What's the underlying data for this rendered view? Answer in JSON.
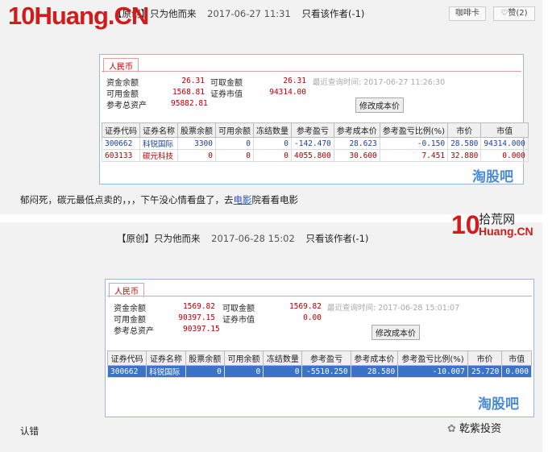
{
  "post1": {
    "header": {
      "title": "【原创】只为他而来",
      "time": "2017-06-27 11:31",
      "only_author": "只看该作者(-1)"
    },
    "buttons": {
      "coffee": "咖啡卡",
      "like": "赞(2)"
    },
    "logo": "10Huang.CN",
    "currency_tab": "人民币",
    "funds": {
      "balance_label": "资金余额",
      "balance": "26.31",
      "withdraw_label": "可取金额",
      "withdraw": "26.31",
      "query_time": "最近查询时间: 2017-06-27 11:26:30",
      "available_label": "可用金额",
      "available": "1568.81",
      "market_label": "证券市值",
      "market": "94314.00",
      "total_label": "参考总资产",
      "total": "95882.81",
      "modify_btn": "修改成本价"
    },
    "columns": [
      "证券代码",
      "证券名称",
      "股票余额",
      "可用余额",
      "冻结数量",
      "参考盈亏",
      "参考成本价",
      "参考盈亏比例(%)",
      "市价",
      "市值"
    ],
    "rows": [
      [
        "300662",
        "科锐国际",
        "3300",
        "0",
        "0",
        "-142.470",
        "28.623",
        "-0.150",
        "28.580",
        "94314.000"
      ],
      [
        "603133",
        "碳元科技",
        "0",
        "0",
        "0",
        "4055.800",
        "30.600",
        "7.451",
        "32.880",
        "0.000"
      ]
    ],
    "watermark": "淘股吧",
    "note_before": "郁闷死，碳元最低点卖的，，，下午没心情看盘了，去",
    "note_link": "电影",
    "note_after": "院看看电影"
  },
  "post2": {
    "header": {
      "title": "【原创】只为他而来",
      "time": "2017-06-28 15:02",
      "only_author": "只看该作者(-1)"
    },
    "currency_tab": "人民币",
    "funds": {
      "balance_label": "资金余额",
      "balance": "1569.82",
      "withdraw_label": "可取金额",
      "withdraw": "1569.82",
      "query_time": "最近查询时间: 2017-06-28 15:01:07",
      "available_label": "可用金额",
      "available": "90397.15",
      "market_label": "证券市值",
      "market": "0.00",
      "total_label": "参考总资产",
      "total": "90397.15",
      "modify_btn": "修改成本价"
    },
    "columns": [
      "证券代码",
      "证券名称",
      "股票余额",
      "可用余额",
      "冻结数量",
      "参考盈亏",
      "参考成本价",
      "参考盈亏比例(%)",
      "市价",
      "市值"
    ],
    "rows": [
      [
        "300662",
        "科锐国际",
        "0",
        "0",
        "0",
        "-5510.250",
        "28.580",
        "-10.007",
        "25.720",
        "0.000"
      ]
    ],
    "watermark": "淘股吧",
    "note": "认错"
  },
  "logo2": {
    "ten": "10",
    "cn": "拾荒网",
    "domain": "Huang.CN"
  },
  "footer_brand": "乾紫投资",
  "colors": {
    "brand_red": "#d21b1b",
    "panel_border": "#9bb8d9",
    "selected_row": "#3a73c8"
  }
}
